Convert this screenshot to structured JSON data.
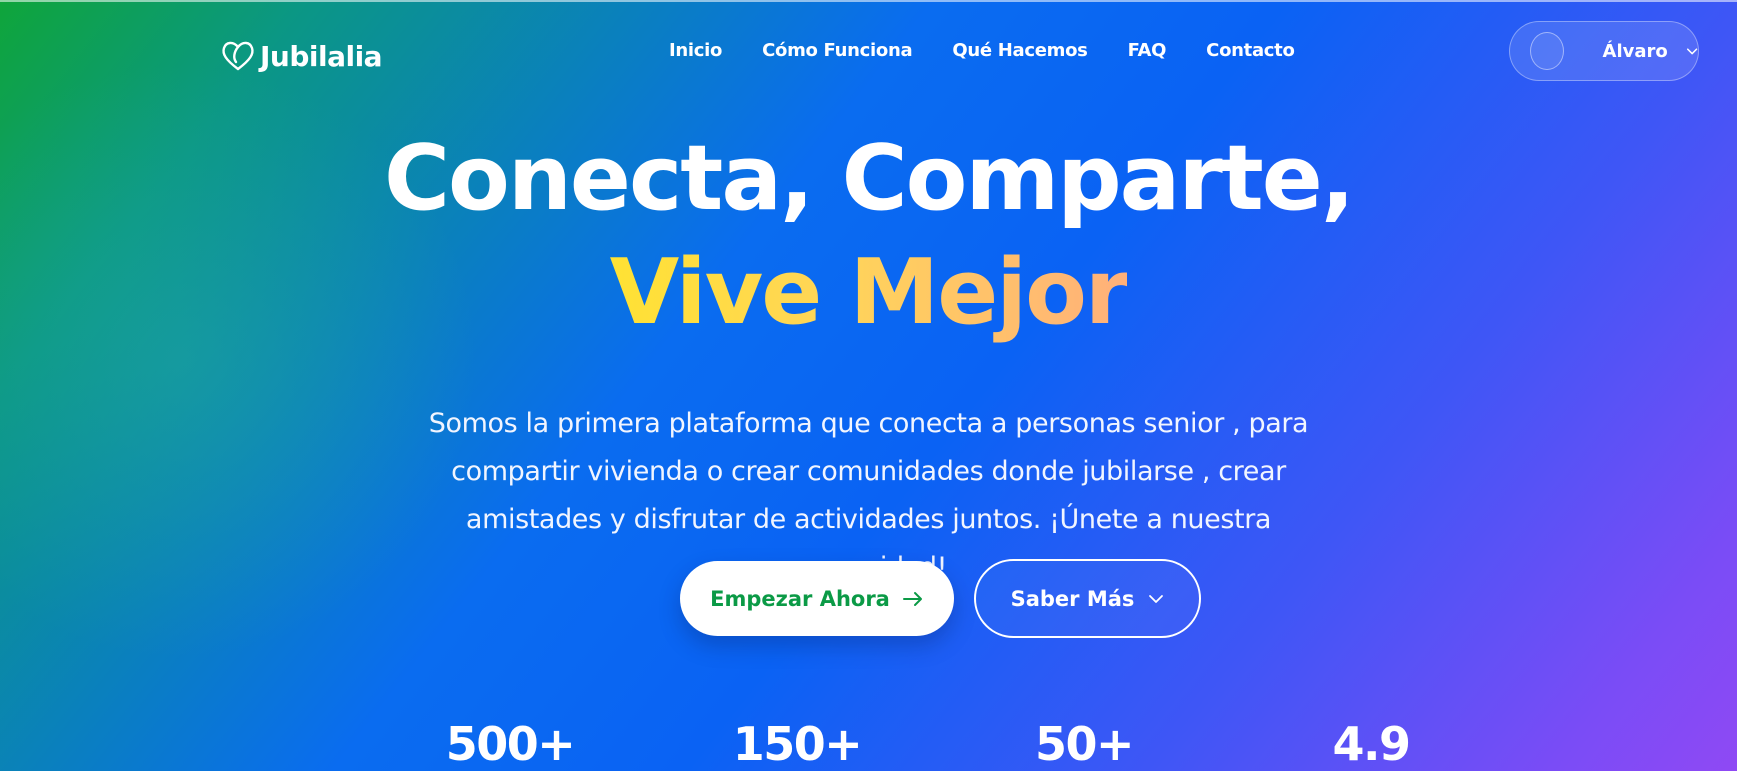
{
  "brand": {
    "name": "Jubilalia",
    "logo_icon": "heart-outline-icon"
  },
  "nav": {
    "items": [
      {
        "label": "Inicio"
      },
      {
        "label": "Cómo Funciona"
      },
      {
        "label": "Qué Hacemos"
      },
      {
        "label": "FAQ"
      },
      {
        "label": "Contacto"
      }
    ]
  },
  "user_menu": {
    "name": "Álvaro",
    "icon": "chevron-down-icon"
  },
  "hero": {
    "headline_line1": "Conecta, Comparte,",
    "headline_line2": "Vive Mejor",
    "subtitle": "Somos la primera plataforma que conecta a personas senior , para compartir vivienda o crear comunidades donde jubilarse , crear amistades y disfrutar de actividades juntos. ¡Únete a nuestra comunidad!",
    "primary_button": "Empezar Ahora",
    "secondary_button": "Saber Más"
  },
  "stats": [
    {
      "value": "500+"
    },
    {
      "value": "150+"
    },
    {
      "value": "50+"
    },
    {
      "value": "4.9"
    }
  ],
  "colors": {
    "gradient_start": "#0fa53a",
    "gradient_mid": "#0a6cf0",
    "gradient_end": "#8f49f4",
    "accent_yellow": "#ffe233",
    "primary_button_text": "#0b9a46"
  }
}
